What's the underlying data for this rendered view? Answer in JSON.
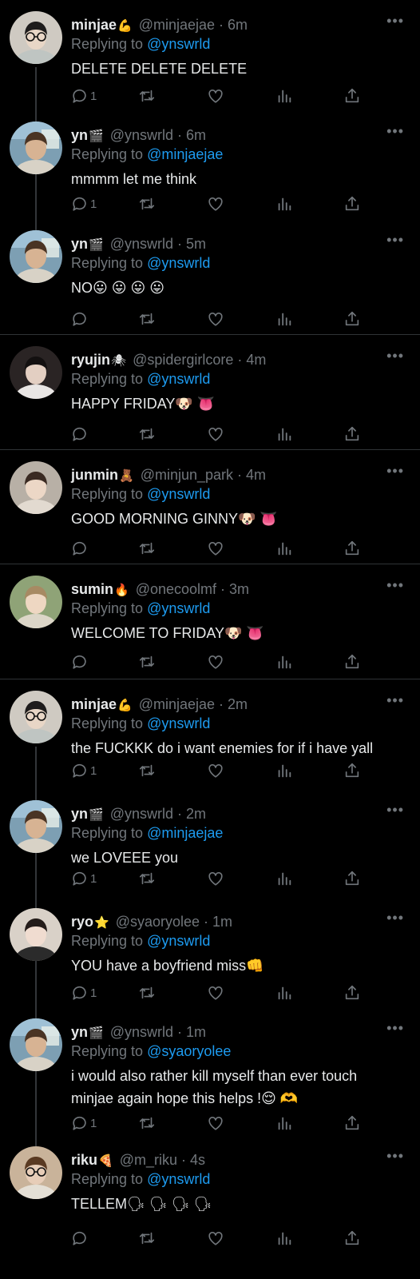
{
  "tweets": [
    {
      "name": "minjae",
      "badge": "💪",
      "handle": "@minjaejae",
      "time": "6m",
      "reply_label": "Replying to",
      "reply_to": "@ynswrld",
      "text": "DELETE DELETE DELETE",
      "reply_count": "1",
      "avatar": "minjae"
    },
    {
      "name": "yn",
      "badge": "🎬",
      "handle": "@ynswrld",
      "time": "6m",
      "reply_label": "Replying to",
      "reply_to": "@minjaejae",
      "text": "mmmm let me think",
      "reply_count": "1",
      "avatar": "yn"
    },
    {
      "name": "yn",
      "badge": "🎬",
      "handle": "@ynswrld",
      "time": "5m",
      "reply_label": "Replying to",
      "reply_to": "@ynswrld",
      "text": "NO😛 😛 😛 😛",
      "reply_count": "",
      "avatar": "yn"
    },
    {
      "name": "ryujin",
      "badge": "🕷",
      "handle": "@spidergirlcore",
      "time": "4m",
      "reply_label": "Replying to",
      "reply_to": "@ynswrld",
      "text": "HAPPY FRIDAY🐶 👅",
      "reply_count": "",
      "avatar": "ryujin"
    },
    {
      "name": "junmin",
      "badge": "🧸",
      "handle": "@minjun_park",
      "time": "4m",
      "reply_label": "Replying to",
      "reply_to": "@ynswrld",
      "text": "GOOD MORNING GINNY🐶 👅",
      "reply_count": "",
      "avatar": "junmin"
    },
    {
      "name": "sumin",
      "badge": "🔥",
      "handle": "@onecoolmf",
      "time": "3m",
      "reply_label": "Replying to",
      "reply_to": "@ynswrld",
      "text": "WELCOME TO FRIDAY🐶 👅",
      "reply_count": "",
      "avatar": "sumin"
    },
    {
      "name": "minjae",
      "badge": "💪",
      "handle": "@minjaejae",
      "time": "2m",
      "reply_label": "Replying to",
      "reply_to": "@ynswrld",
      "text": "the FUCKKK do i want enemies for if i have yall",
      "reply_count": "1",
      "avatar": "minjae"
    },
    {
      "name": "yn",
      "badge": "🎬",
      "handle": "@ynswrld",
      "time": "2m",
      "reply_label": "Replying to",
      "reply_to": "@minjaejae",
      "text": "we LOVEEE you",
      "reply_count": "1",
      "avatar": "yn"
    },
    {
      "name": "ryo",
      "badge": "⭐",
      "handle": "@syaoryolee",
      "time": "1m",
      "reply_label": "Replying to",
      "reply_to": "@ynswrld",
      "text": "YOU have a boyfriend miss👊",
      "reply_count": "1",
      "avatar": "ryo"
    },
    {
      "name": "yn",
      "badge": "🎬",
      "handle": "@ynswrld",
      "time": "1m",
      "reply_label": "Replying to",
      "reply_to": "@syaoryolee",
      "text": "i would also rather kill myself than ever touch minjae again hope this helps !😌 🫶",
      "reply_count": "1",
      "avatar": "yn"
    },
    {
      "name": "riku",
      "badge": "🍕",
      "handle": "@m_riku",
      "time": "4s",
      "reply_label": "Replying to",
      "reply_to": "@ynswrld",
      "text": "TELLEM🗣 🗣 🗣 🗣",
      "reply_count": "",
      "avatar": "riku"
    }
  ],
  "icons": {
    "more": "more-horizontal-icon",
    "reply": "reply-bubble-icon",
    "retweet": "retweet-icon",
    "like": "heart-icon",
    "views": "views-bar-chart-icon",
    "share": "share-upload-icon"
  },
  "colors": {
    "background": "#000000",
    "text": "#e7e9ea",
    "muted": "#71767b",
    "link": "#1d9bf0",
    "divider": "#2f3336"
  }
}
